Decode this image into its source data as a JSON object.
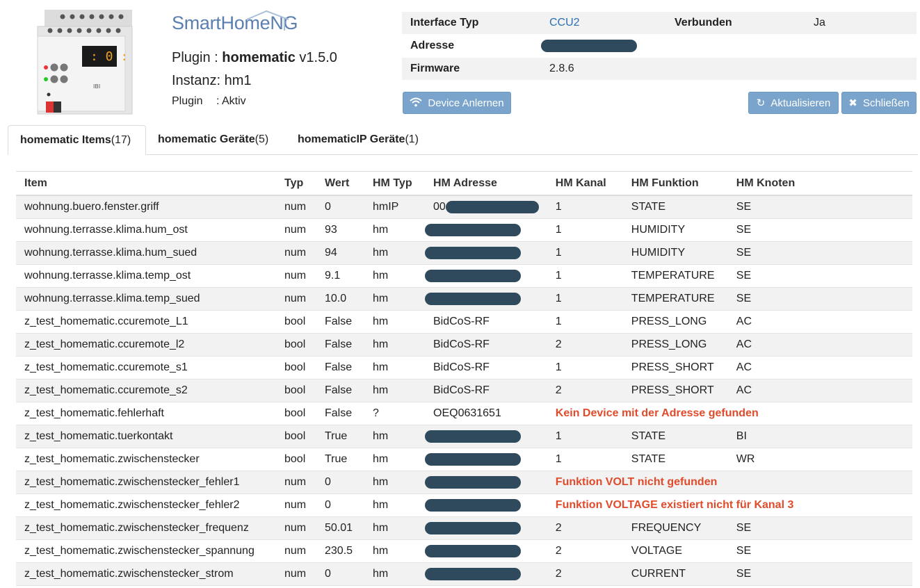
{
  "logo": {
    "text_main": "SmartHome",
    "text_ng": "NG"
  },
  "plugin": {
    "prefix": "Plugin : ",
    "name": "homematic",
    "version": " v1.5.0",
    "instanz": "Instanz: hm1",
    "status_label": "Plugin",
    "status_value": ": Aktiv"
  },
  "device_display": "0",
  "info": {
    "interface_typ_label": "Interface Typ",
    "interface_typ_value": "CCU2",
    "verbunden_label": "Verbunden",
    "verbunden_value": "Ja",
    "adresse_label": "Adresse",
    "firmware_label": "Firmware",
    "firmware_value": "2.8.6"
  },
  "buttons": {
    "device_anlernen": "Device Anlernen",
    "aktualisieren": "Aktualisieren",
    "schliessen": "Schließen"
  },
  "tabs": [
    {
      "label": "homematic Items",
      "count": " (17)"
    },
    {
      "label": "homematic Geräte",
      "count": " (5)"
    },
    {
      "label": "homematicIP Geräte",
      "count": " (1)"
    }
  ],
  "columns": [
    "Item",
    "Typ",
    "Wert",
    "HM Typ",
    "HM Adresse",
    "HM Kanal",
    "HM Funktion",
    "HM Knoten"
  ],
  "rows": [
    {
      "item": "wohnung.buero.fenster.griff",
      "typ": "num",
      "wert": "0",
      "hmtyp": "hmIP",
      "adresse": "00",
      "kanal": "1",
      "funktion": "STATE",
      "knoten": "SE",
      "redacted": true
    },
    {
      "item": "wohnung.terrasse.klima.hum_ost",
      "typ": "num",
      "wert": "93",
      "hmtyp": "hm",
      "adresse": "",
      "kanal": "1",
      "funktion": "HUMIDITY",
      "knoten": "SE",
      "redacted": true
    },
    {
      "item": "wohnung.terrasse.klima.hum_sued",
      "typ": "num",
      "wert": "94",
      "hmtyp": "hm",
      "adresse": "",
      "kanal": "1",
      "funktion": "HUMIDITY",
      "knoten": "SE",
      "redacted": true
    },
    {
      "item": "wohnung.terrasse.klima.temp_ost",
      "typ": "num",
      "wert": "9.1",
      "hmtyp": "hm",
      "adresse": "",
      "kanal": "1",
      "funktion": "TEMPERATURE",
      "knoten": "SE",
      "redacted": true
    },
    {
      "item": "wohnung.terrasse.klima.temp_sued",
      "typ": "num",
      "wert": "10.0",
      "hmtyp": "hm",
      "adresse": "",
      "kanal": "1",
      "funktion": "TEMPERATURE",
      "knoten": "SE",
      "redacted": true
    },
    {
      "item": "z_test_homematic.ccuremote_L1",
      "typ": "bool",
      "wert": "False",
      "hmtyp": "hm",
      "adresse": "BidCoS-RF",
      "kanal": "1",
      "funktion": "PRESS_LONG",
      "knoten": "AC",
      "redacted": false
    },
    {
      "item": "z_test_homematic.ccuremote_l2",
      "typ": "bool",
      "wert": "False",
      "hmtyp": "hm",
      "adresse": "BidCoS-RF",
      "kanal": "2",
      "funktion": "PRESS_LONG",
      "knoten": "AC",
      "redacted": false
    },
    {
      "item": "z_test_homematic.ccuremote_s1",
      "typ": "bool",
      "wert": "False",
      "hmtyp": "hm",
      "adresse": "BidCoS-RF",
      "kanal": "1",
      "funktion": "PRESS_SHORT",
      "knoten": "AC",
      "redacted": false
    },
    {
      "item": "z_test_homematic.ccuremote_s2",
      "typ": "bool",
      "wert": "False",
      "hmtyp": "hm",
      "adresse": "BidCoS-RF",
      "kanal": "2",
      "funktion": "PRESS_SHORT",
      "knoten": "AC",
      "redacted": false
    },
    {
      "item": "z_test_homematic.fehlerhaft",
      "typ": "bool",
      "wert": "False",
      "hmtyp": "?",
      "adresse": "OEQ0631651",
      "error": "Kein Device mit der Adresse gefunden",
      "redacted": false
    },
    {
      "item": "z_test_homematic.tuerkontakt",
      "typ": "bool",
      "wert": "True",
      "hmtyp": "hm",
      "adresse": "",
      "kanal": "1",
      "funktion": "STATE",
      "knoten": "BI",
      "redacted": true
    },
    {
      "item": "z_test_homematic.zwischenstecker",
      "typ": "bool",
      "wert": "True",
      "hmtyp": "hm",
      "adresse": "",
      "kanal": "1",
      "funktion": "STATE",
      "knoten": "WR",
      "redacted": true
    },
    {
      "item": "z_test_homematic.zwischenstecker_fehler1",
      "typ": "num",
      "wert": "0",
      "hmtyp": "hm",
      "adresse": "",
      "error": "Funktion VOLT nicht gefunden",
      "redacted": true
    },
    {
      "item": "z_test_homematic.zwischenstecker_fehler2",
      "typ": "num",
      "wert": "0",
      "hmtyp": "hm",
      "adresse": "",
      "error": "Funktion VOLTAGE existiert nicht für Kanal 3",
      "redacted": true
    },
    {
      "item": "z_test_homematic.zwischenstecker_frequenz",
      "typ": "num",
      "wert": "50.01",
      "hmtyp": "hm",
      "adresse": "",
      "kanal": "2",
      "funktion": "FREQUENCY",
      "knoten": "SE",
      "redacted": true
    },
    {
      "item": "z_test_homematic.zwischenstecker_spannung",
      "typ": "num",
      "wert": "230.5",
      "hmtyp": "hm",
      "adresse": "",
      "kanal": "2",
      "funktion": "VOLTAGE",
      "knoten": "SE",
      "redacted": true
    },
    {
      "item": "z_test_homematic.zwischenstecker_strom",
      "typ": "num",
      "wert": "0",
      "hmtyp": "hm",
      "adresse": "",
      "kanal": "2",
      "funktion": "CURRENT",
      "knoten": "SE",
      "redacted": true
    }
  ],
  "colors": {
    "button": "#7aa4cc",
    "error": "#e04b2b",
    "link": "#2a6fb3",
    "redaction": "#2e4a5c"
  }
}
